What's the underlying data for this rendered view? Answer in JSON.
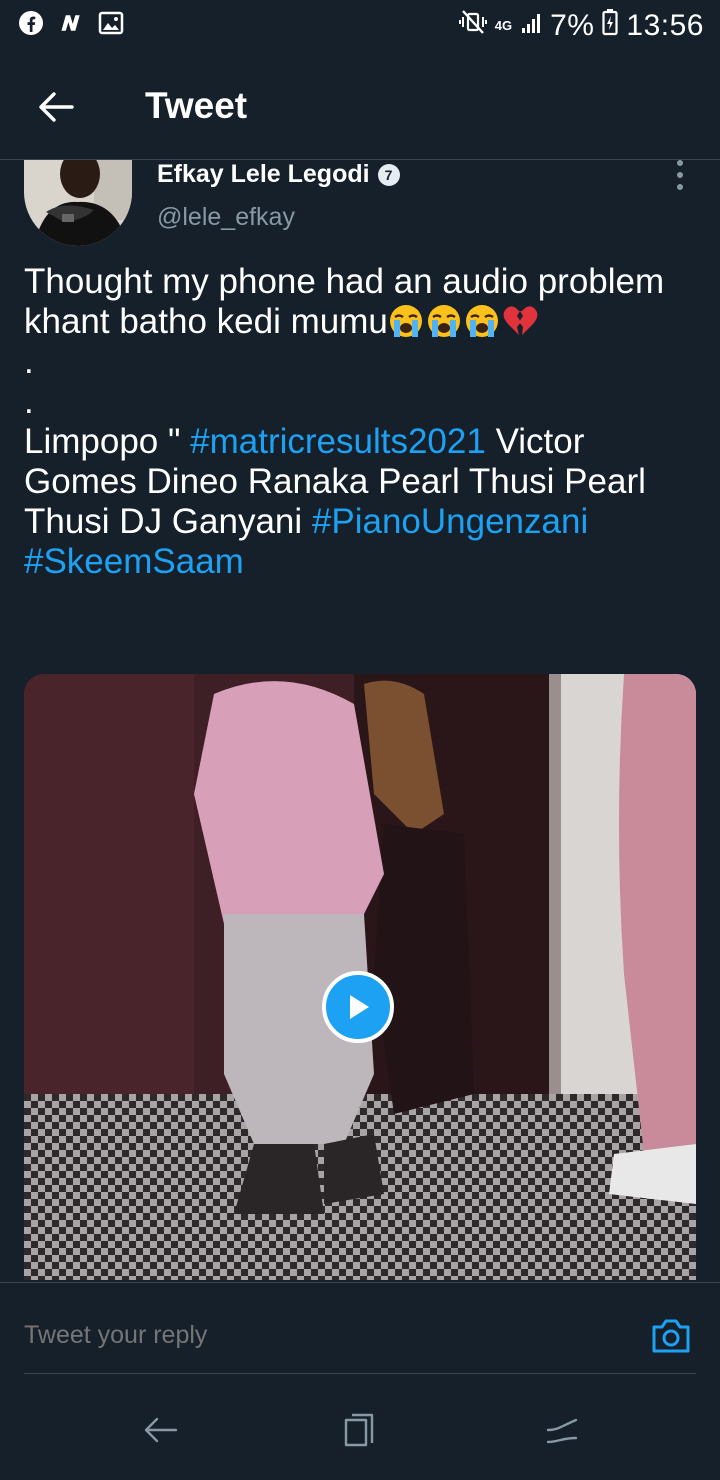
{
  "status_bar": {
    "time": "13:56",
    "battery": "7%",
    "network": "4G",
    "icons": [
      "facebook-icon",
      "news-icon",
      "gallery-icon",
      "mute-vibrate-icon",
      "signal-icon",
      "battery-icon"
    ]
  },
  "header": {
    "title": "Tweet",
    "back_icon": "back-arrow-icon"
  },
  "tweet": {
    "author_name": "Efkay Lele Legodi",
    "author_handle": "@lele_efkay",
    "verified_badge": "7",
    "text_lines": {
      "l1": "Thought my phone had an audio problem",
      "l2": "khant batho kedi mumu",
      "l3": ".",
      "l4": ".",
      "l5_prefix": "Limpopo \" ",
      "l5_tag": "#matricresults2021",
      "l5_suffix": " Victor",
      "l6": "Gomes Dineo Ranaka Pearl Thusi Pearl",
      "l7_prefix": "Thusi DJ Ganyani ",
      "l7_tag": "#PianoUngenzani",
      "l8_tag": "#SkeemSaam"
    },
    "emojis": [
      "loudly-crying-face-icon",
      "loudly-crying-face-icon",
      "loudly-crying-face-icon",
      "broken-heart-icon"
    ],
    "media": {
      "type": "video",
      "play_icon": "play-icon"
    }
  },
  "reply": {
    "placeholder": "Tweet your reply",
    "camera_icon": "camera-icon"
  },
  "nav_bar": {
    "icons": [
      "back-nav-icon",
      "recents-icon",
      "home-nav-icon"
    ]
  },
  "colors": {
    "background": "#15202b",
    "accent": "#1da1f2",
    "secondary_text": "#8899a6",
    "divider": "#38444d"
  }
}
